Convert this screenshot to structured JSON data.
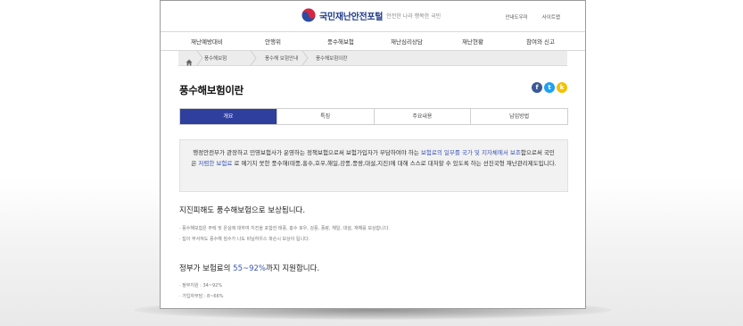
{
  "site": {
    "title": "국민재난안전포털",
    "slogan": "안전한 나라 행복한 국민"
  },
  "utility": [
    "안내도우미",
    "사이트맵"
  ],
  "gnb": [
    "재난예방대비",
    "안행위",
    "풍수해보험",
    "재난심리상담",
    "재난현황",
    "참여와 신고"
  ],
  "breadcrumb": [
    "풍수해보험",
    "풍수해 보험안내",
    "풍수해보험이란"
  ],
  "page_title": "풍수해보험이란",
  "share": {
    "facebook": "f",
    "twitter": "t",
    "kakao": "k",
    "colors": {
      "facebook": "#3b5998",
      "twitter": "#1da1f2",
      "kakao": "#f2c200"
    }
  },
  "tabs": [
    "개요",
    "특징",
    "주요내용",
    "납입방법"
  ],
  "intro": {
    "part1": "행정안전부가 관장하고 민영보험사가 운영하는 정책보험으로써 보험가입자가 부담하여야 하는",
    "hl1": "보험료의 일부를 국가 및 지자체에서 보조",
    "part2": "함으로써 국민은",
    "hl2": "저렴한 보험료",
    "part3": "로 예기치 못한 풍수해(태풍,홍수,호우,해일,강풍,풍랑,대설,지진)에 대해 스스로 대처할 수 있도록 하는 선진국형 재난관리제도입니다."
  },
  "section1": {
    "heading": "지진피해도 풍수해보험으로 보상됩니다.",
    "items": [
      "· 풍수해보험은 주택 및 온실에 대하여 지진을 포함한 태풍, 홍수 호우, 강풍, 풍랑, 해일, 대설, 재해를 보상합니다.",
      "· 집이 부서져도 풍수해 침수가 나도 비닐하우스 파손시 보상이 됩니다."
    ]
  },
  "section2": {
    "heading_a": "정부가 보험료의",
    "heading_b": "55~92%",
    "heading_c": "까지 지원합니다.",
    "items": [
      "· 정부지원 : 34~92%",
      "· 가입자부담 : 8~66%"
    ]
  },
  "colors": {
    "brand": "#1f3a8a",
    "tab_active": "#2f3f9e",
    "highlight": "#3b55b5"
  }
}
